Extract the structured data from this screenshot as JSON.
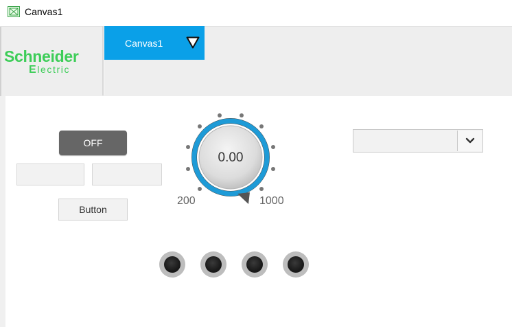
{
  "window": {
    "title": "Canvas1",
    "icon": "canvas-app-icon"
  },
  "header": {
    "logo": {
      "line1": "Schneider",
      "line2_initial": "E",
      "line2_rest": "lectric",
      "color": "#3dcd58"
    },
    "tab": {
      "label": "Canvas1",
      "color": "#0aa0e8",
      "icon": "dropdown-triangle-icon"
    }
  },
  "canvas": {
    "toggle_button": {
      "label": "OFF",
      "state": "off"
    },
    "text_fields": [
      {
        "value": ""
      },
      {
        "value": ""
      }
    ],
    "push_button": {
      "label": "Button"
    },
    "knob": {
      "value_text": "0.00",
      "min_label": "200",
      "max_label": "1000",
      "ring_color": "#1e9bd7"
    },
    "combo_box": {
      "selected": "",
      "icon": "chevron-down-icon"
    },
    "indicators": [
      {
        "state": "off"
      },
      {
        "state": "off"
      },
      {
        "state": "off"
      },
      {
        "state": "off"
      }
    ]
  }
}
